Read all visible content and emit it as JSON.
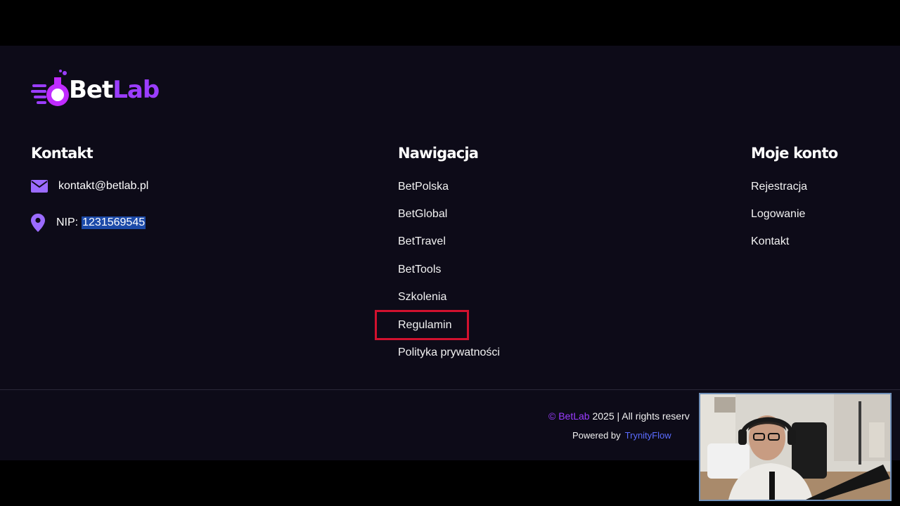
{
  "brand": {
    "name_part1": "Bet",
    "name_part2": "Lab"
  },
  "contact": {
    "heading": "Kontakt",
    "email": "kontakt@betlab.pl",
    "nip_label": "NIP:",
    "nip_value": "1231569545"
  },
  "navigation": {
    "heading": "Nawigacja",
    "items": [
      "BetPolska",
      "BetGlobal",
      "BetTravel",
      "BetTools",
      "Szkolenia",
      "Regulamin",
      "Polityka prywatności"
    ]
  },
  "account": {
    "heading": "Moje konto",
    "items": [
      "Rejestracja",
      "Logowanie",
      "Kontakt"
    ]
  },
  "footer": {
    "copyright_symbol": "©",
    "copyright_brand": "BetLab",
    "copyright_text": "2025 | All rights reserv",
    "powered_label": "Powered by",
    "powered_brand": "TrynityFlow"
  },
  "colors": {
    "accent": "#9b3dff",
    "highlight": "#d2112e",
    "background": "#0d0b18"
  }
}
